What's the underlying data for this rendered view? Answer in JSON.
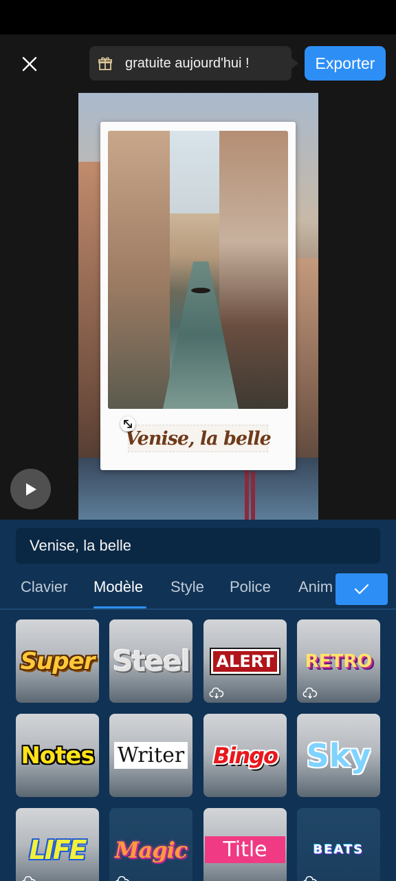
{
  "topbar": {
    "promo_text": "gratuite aujourd'hui !",
    "export_label": "Exporter"
  },
  "preview": {
    "caption_text": "Venise, la belle"
  },
  "panel": {
    "input_value": "Venise, la belle",
    "tabs": [
      {
        "label": "Clavier",
        "active": false
      },
      {
        "label": "Modèle",
        "active": true
      },
      {
        "label": "Style",
        "active": false
      },
      {
        "label": "Police",
        "active": false
      },
      {
        "label": "Anim",
        "active": false
      }
    ],
    "templates": [
      {
        "label": "Super",
        "download": false
      },
      {
        "label": "Steel",
        "download": false
      },
      {
        "label": "ALERT",
        "download": true
      },
      {
        "label": "RETRO",
        "download": true
      },
      {
        "label": "Notes",
        "download": false
      },
      {
        "label": "Writer",
        "download": false
      },
      {
        "label": "Bingo",
        "download": false
      },
      {
        "label": "Sky",
        "download": false
      },
      {
        "label": "LIFE",
        "download": true
      },
      {
        "label": "Magic",
        "download": true
      },
      {
        "label": "Title",
        "download": false
      },
      {
        "label": "BEATS",
        "download": true
      }
    ]
  },
  "colors": {
    "accent": "#2d8ff6",
    "panel_bg": "#103254",
    "caption_text": "#6e3a1a"
  },
  "icons": [
    "close-icon",
    "gift-icon",
    "play-icon",
    "resize-icon",
    "check-icon",
    "cloud-download-icon"
  ]
}
